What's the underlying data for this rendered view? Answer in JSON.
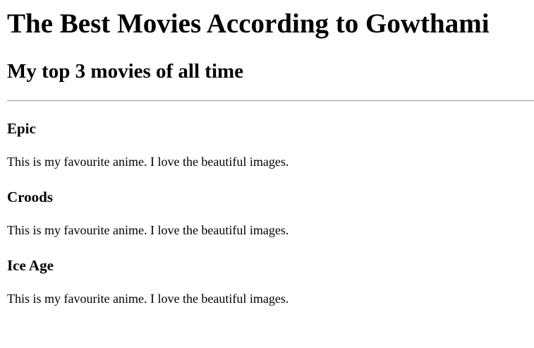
{
  "page": {
    "title": "The Best Movies According to Gowthami",
    "subtitle": "My top 3 movies of all time"
  },
  "movies": [
    {
      "name": "Epic",
      "description": "This is my favourite anime. I love the beautiful images."
    },
    {
      "name": "Croods",
      "description": "This is my favourite anime. I love the beautiful images."
    },
    {
      "name": "Ice Age",
      "description": "This is my favourite anime. I love the beautiful images."
    }
  ]
}
